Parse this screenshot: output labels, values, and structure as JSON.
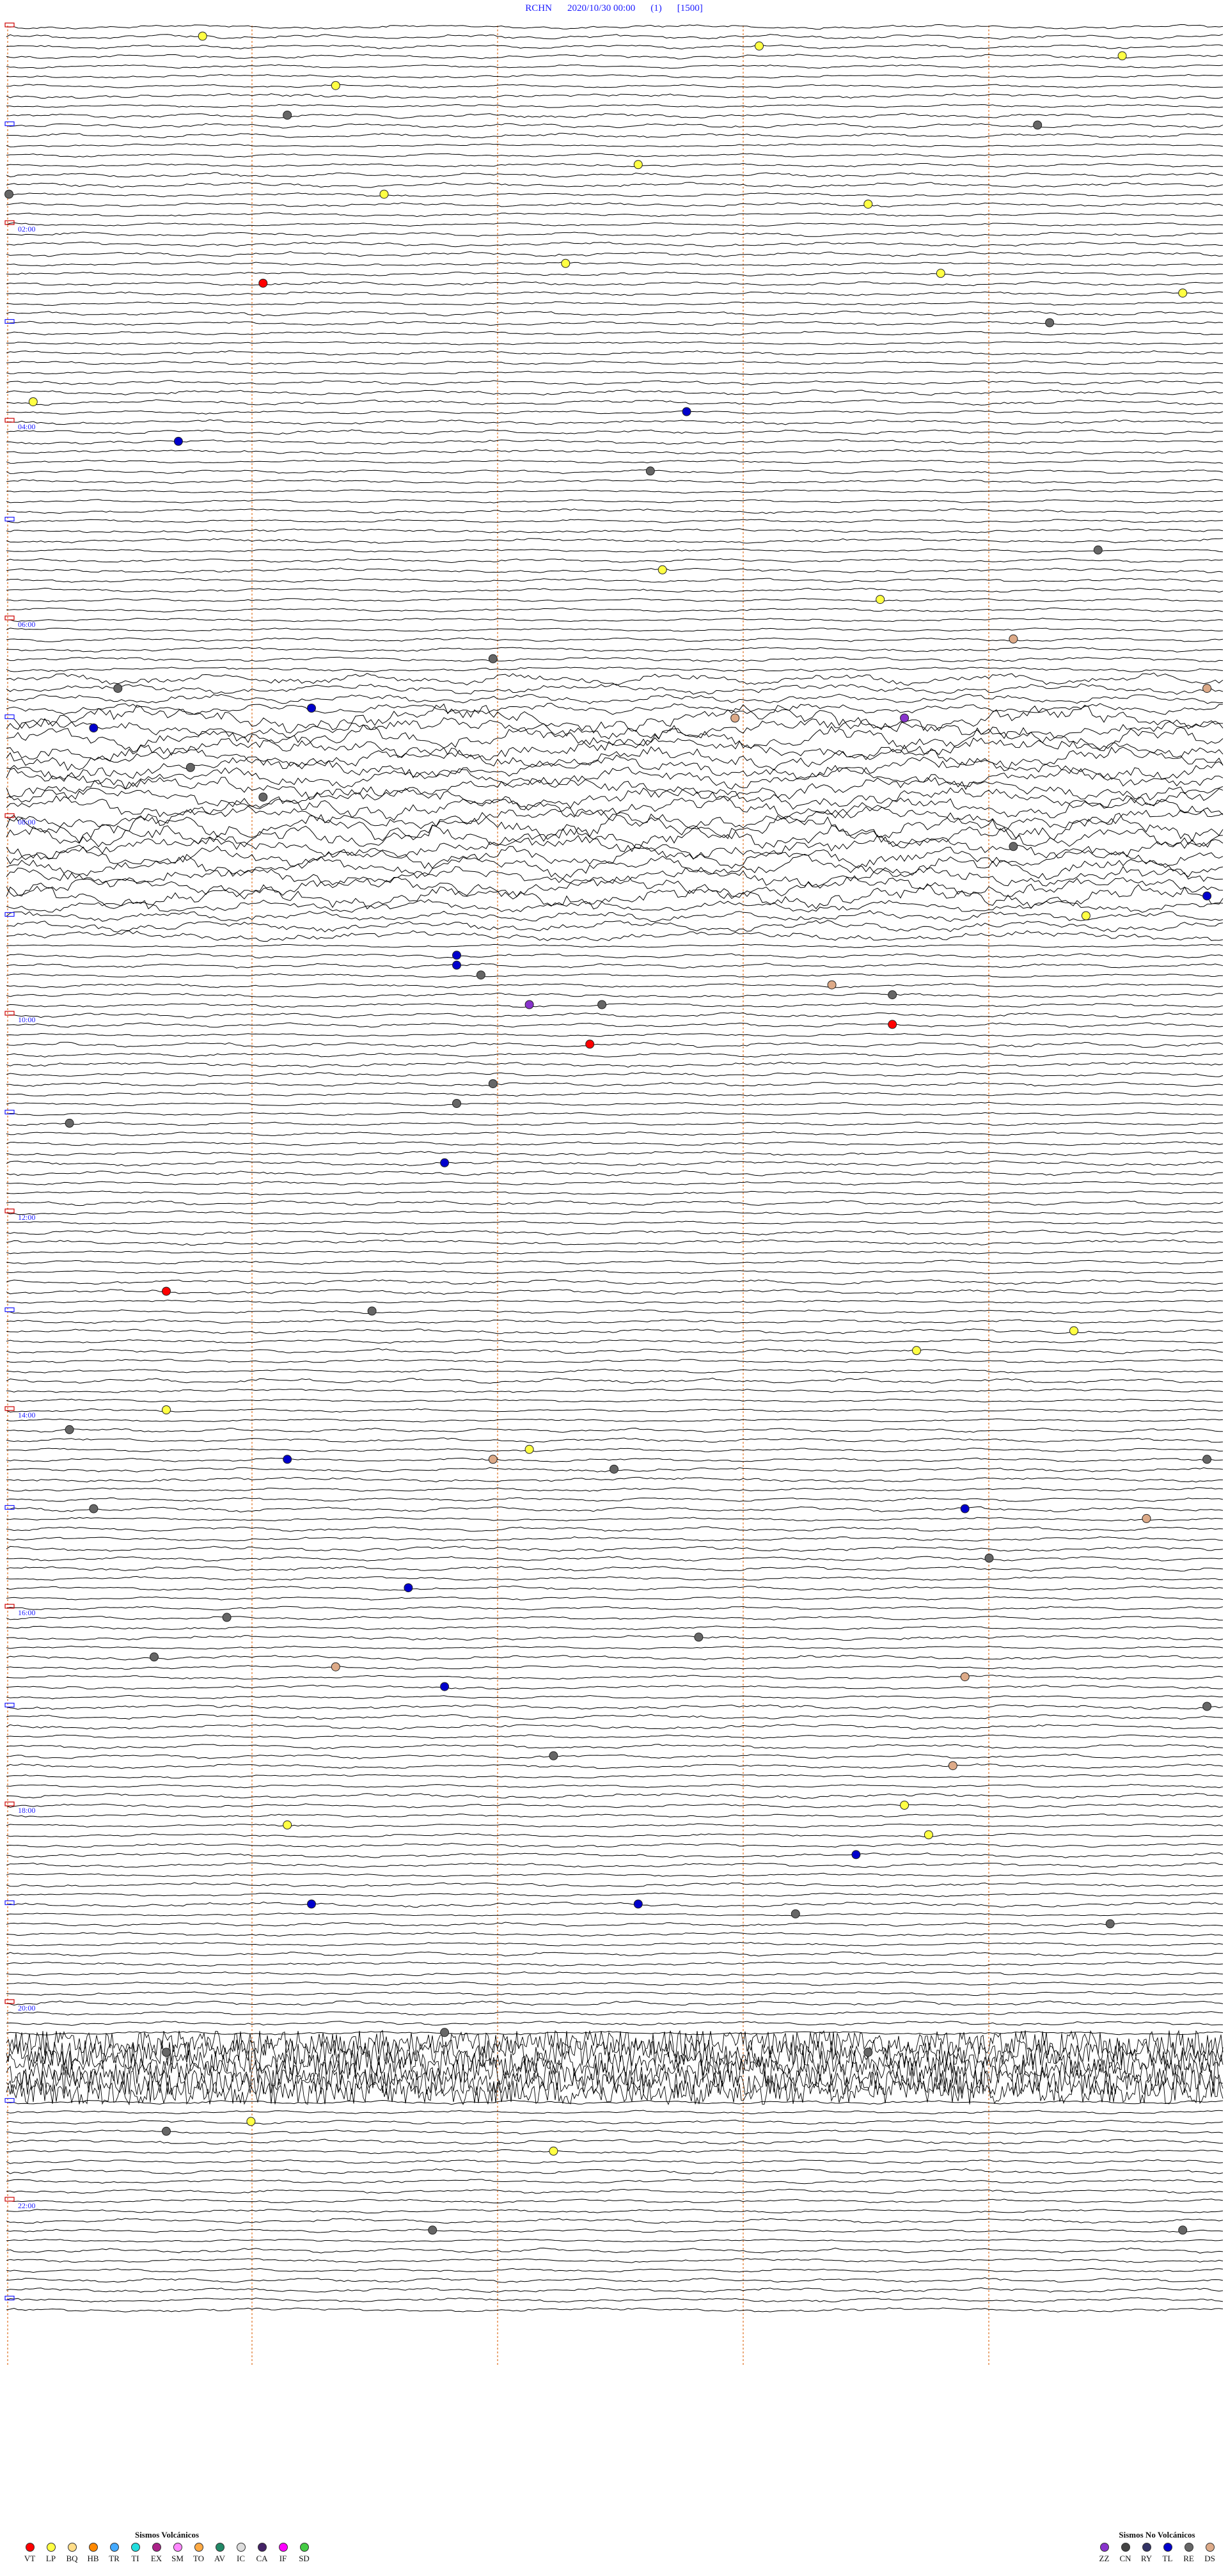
{
  "header": {
    "station": "RCHN",
    "datetime": "2020/10/30 00:00",
    "channel": "(1)",
    "scale": "[1500]"
  },
  "hour_labels": [
    "02:00",
    "04:00",
    "06:00",
    "08:00",
    "10:00",
    "12:00",
    "14:00",
    "16:00",
    "18:00",
    "20:00",
    "22:00"
  ],
  "colors": {
    "trace": "#000000",
    "minute_markers": "#e07020",
    "hour_label": "#1a1aff",
    "left_tick": "#cc0000"
  },
  "legend_volcanic": {
    "title": "Sismos Volcánicos",
    "items": [
      {
        "code": "VT",
        "color": "#ff0000"
      },
      {
        "code": "LP",
        "color": "#ffff44"
      },
      {
        "code": "BQ",
        "color": "#ffdd88"
      },
      {
        "code": "HB",
        "color": "#ff8800"
      },
      {
        "code": "TR",
        "color": "#44aaff"
      },
      {
        "code": "TI",
        "color": "#22dddd"
      },
      {
        "code": "EX",
        "color": "#aa2288"
      },
      {
        "code": "SM",
        "color": "#ff88ff"
      },
      {
        "code": "TO",
        "color": "#ffaa44"
      },
      {
        "code": "AV",
        "color": "#228866"
      },
      {
        "code": "IC",
        "color": "#dddddd"
      },
      {
        "code": "CA",
        "color": "#442266"
      },
      {
        "code": "IF",
        "color": "#ff00ff"
      },
      {
        "code": "SD",
        "color": "#44cc44"
      }
    ]
  },
  "legend_nonvolcanic": {
    "title": "Sismos No Volcánicos",
    "items": [
      {
        "code": "ZZ",
        "color": "#8833cc"
      },
      {
        "code": "CN",
        "color": "#444444"
      },
      {
        "code": "RY",
        "color": "#333366"
      },
      {
        "code": "TL",
        "color": "#0000cc"
      },
      {
        "code": "RE",
        "color": "#666666"
      },
      {
        "code": "DS",
        "color": "#ddaa88"
      }
    ]
  },
  "event_markers": [
    {
      "row": 1,
      "t": 0.16,
      "type": "LP"
    },
    {
      "row": 2,
      "t": 0.62,
      "type": "LP"
    },
    {
      "row": 3,
      "t": 0.92,
      "type": "LP"
    },
    {
      "row": 6,
      "t": 0.27,
      "type": "LP"
    },
    {
      "row": 9,
      "t": 0.23,
      "type": "RE"
    },
    {
      "row": 10,
      "t": 0.85,
      "type": "RE"
    },
    {
      "row": 14,
      "t": 0.52,
      "type": "LP"
    },
    {
      "row": 17,
      "t": 0.31,
      "type": "LP"
    },
    {
      "row": 18,
      "t": 0.71,
      "type": "LP"
    },
    {
      "row": 17,
      "t": 0.0,
      "type": "RE"
    },
    {
      "row": 24,
      "t": 0.46,
      "type": "LP"
    },
    {
      "row": 25,
      "t": 0.77,
      "type": "LP"
    },
    {
      "row": 26,
      "t": 0.21,
      "type": "VT"
    },
    {
      "row": 27,
      "t": 0.97,
      "type": "LP"
    },
    {
      "row": 30,
      "t": 0.86,
      "type": "RE"
    },
    {
      "row": 38,
      "t": 0.02,
      "type": "LP"
    },
    {
      "row": 39,
      "t": 0.56,
      "type": "TL"
    },
    {
      "row": 42,
      "t": 0.14,
      "type": "TL"
    },
    {
      "row": 45,
      "t": 0.53,
      "type": "RE"
    },
    {
      "row": 53,
      "t": 0.9,
      "type": "RE"
    },
    {
      "row": 55,
      "t": 0.54,
      "type": "LP"
    },
    {
      "row": 58,
      "t": 0.72,
      "type": "LP"
    },
    {
      "row": 62,
      "t": 0.83,
      "type": "DS"
    },
    {
      "row": 64,
      "t": 0.4,
      "type": "RE"
    },
    {
      "row": 67,
      "t": 0.09,
      "type": "RE"
    },
    {
      "row": 67,
      "t": 0.99,
      "type": "DS"
    },
    {
      "row": 69,
      "t": 0.25,
      "type": "TL"
    },
    {
      "row": 70,
      "t": 0.6,
      "type": "DS"
    },
    {
      "row": 70,
      "t": 0.74,
      "type": "ZZ"
    },
    {
      "row": 71,
      "t": 0.07,
      "type": "TL"
    },
    {
      "row": 75,
      "t": 0.15,
      "type": "RE"
    },
    {
      "row": 78,
      "t": 0.21,
      "type": "RE"
    },
    {
      "row": 83,
      "t": 0.83,
      "type": "RE"
    },
    {
      "row": 88,
      "t": 0.99,
      "type": "TL"
    },
    {
      "row": 90,
      "t": 0.89,
      "type": "LP"
    },
    {
      "row": 94,
      "t": 0.37,
      "type": "TL"
    },
    {
      "row": 95,
      "t": 0.37,
      "type": "TL"
    },
    {
      "row": 96,
      "t": 0.39,
      "type": "RE"
    },
    {
      "row": 97,
      "t": 0.68,
      "type": "DS"
    },
    {
      "row": 98,
      "t": 0.73,
      "type": "RE"
    },
    {
      "row": 99,
      "t": 0.49,
      "type": "RE"
    },
    {
      "row": 99,
      "t": 0.43,
      "type": "ZZ"
    },
    {
      "row": 101,
      "t": 0.73,
      "type": "VT"
    },
    {
      "row": 103,
      "t": 0.48,
      "type": "VT"
    },
    {
      "row": 107,
      "t": 0.4,
      "type": "RE"
    },
    {
      "row": 109,
      "t": 0.37,
      "type": "RE"
    },
    {
      "row": 111,
      "t": 0.05,
      "type": "RE"
    },
    {
      "row": 115,
      "t": 0.36,
      "type": "TL"
    },
    {
      "row": 128,
      "t": 0.13,
      "type": "VT"
    },
    {
      "row": 130,
      "t": 0.3,
      "type": "RE"
    },
    {
      "row": 132,
      "t": 0.88,
      "type": "LP"
    },
    {
      "row": 134,
      "t": 0.75,
      "type": "LP"
    },
    {
      "row": 140,
      "t": 0.13,
      "type": "LP"
    },
    {
      "row": 142,
      "t": 0.05,
      "type": "RE"
    },
    {
      "row": 144,
      "t": 0.43,
      "type": "LP"
    },
    {
      "row": 145,
      "t": 0.23,
      "type": "TL"
    },
    {
      "row": 145,
      "t": 0.4,
      "type": "DS"
    },
    {
      "row": 145,
      "t": 0.99,
      "type": "RE"
    },
    {
      "row": 146,
      "t": 0.5,
      "type": "RE"
    },
    {
      "row": 150,
      "t": 0.07,
      "type": "RE"
    },
    {
      "row": 150,
      "t": 0.79,
      "type": "TL"
    },
    {
      "row": 151,
      "t": 0.94,
      "type": "DS"
    },
    {
      "row": 155,
      "t": 0.81,
      "type": "RE"
    },
    {
      "row": 158,
      "t": 0.33,
      "type": "TL"
    },
    {
      "row": 161,
      "t": 0.18,
      "type": "RE"
    },
    {
      "row": 163,
      "t": 0.57,
      "type": "RE"
    },
    {
      "row": 165,
      "t": 0.12,
      "type": "RE"
    },
    {
      "row": 166,
      "t": 0.27,
      "type": "DS"
    },
    {
      "row": 167,
      "t": 0.79,
      "type": "DS"
    },
    {
      "row": 168,
      "t": 0.36,
      "type": "TL"
    },
    {
      "row": 170,
      "t": 0.99,
      "type": "RE"
    },
    {
      "row": 175,
      "t": 0.45,
      "type": "RE"
    },
    {
      "row": 176,
      "t": 0.78,
      "type": "DS"
    },
    {
      "row": 180,
      "t": 0.74,
      "type": "LP"
    },
    {
      "row": 182,
      "t": 0.23,
      "type": "LP"
    },
    {
      "row": 183,
      "t": 0.76,
      "type": "LP"
    },
    {
      "row": 185,
      "t": 0.7,
      "type": "TL"
    },
    {
      "row": 190,
      "t": 0.25,
      "type": "TL"
    },
    {
      "row": 190,
      "t": 0.52,
      "type": "TL"
    },
    {
      "row": 191,
      "t": 0.65,
      "type": "RE"
    },
    {
      "row": 192,
      "t": 0.91,
      "type": "RE"
    },
    {
      "row": 203,
      "t": 0.36,
      "type": "RE"
    },
    {
      "row": 205,
      "t": 0.13,
      "type": "RE"
    },
    {
      "row": 205,
      "t": 0.71,
      "type": "RE"
    },
    {
      "row": 212,
      "t": 0.2,
      "type": "LP"
    },
    {
      "row": 213,
      "t": 0.13,
      "type": "RE"
    },
    {
      "row": 215,
      "t": 0.45,
      "type": "LP"
    },
    {
      "row": 223,
      "t": 0.35,
      "type": "RE"
    },
    {
      "row": 223,
      "t": 0.97,
      "type": "RE"
    }
  ]
}
